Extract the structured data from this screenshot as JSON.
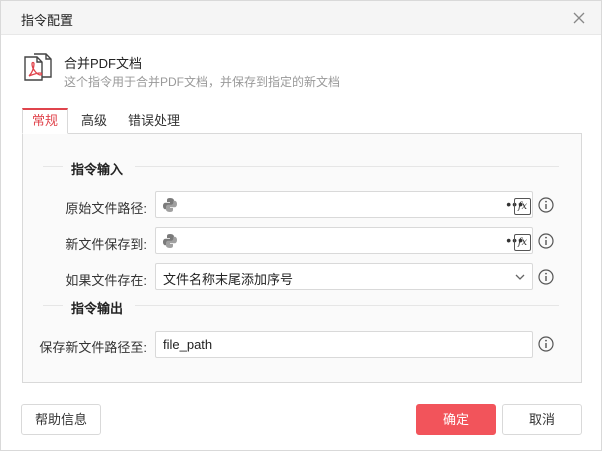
{
  "window": {
    "title": "指令配置"
  },
  "command": {
    "name": "合并PDF文档",
    "description": "这个指令用于合并PDF文档，并保存到指定的新文档"
  },
  "tabs": [
    {
      "label": "常规",
      "active": true
    },
    {
      "label": "高级",
      "active": false
    },
    {
      "label": "错误处理",
      "active": false
    }
  ],
  "input_section": {
    "title": "指令输入",
    "fields": [
      {
        "label": "原始文件路径:",
        "value": "",
        "icon": "python-icon"
      },
      {
        "label": "新文件保存到:",
        "value": "",
        "icon": "python-icon"
      }
    ],
    "if_exists": {
      "label": "如果文件存在:",
      "selected": "文件名称末尾添加序号"
    }
  },
  "output_section": {
    "title": "指令输出",
    "field": {
      "label": "保存新文件路径至:",
      "value": "file_path"
    }
  },
  "buttons": {
    "help": "帮助信息",
    "ok": "确定",
    "cancel": "取消"
  },
  "colors": {
    "accent": "#e0444c",
    "primary_button": "#f2545b"
  }
}
